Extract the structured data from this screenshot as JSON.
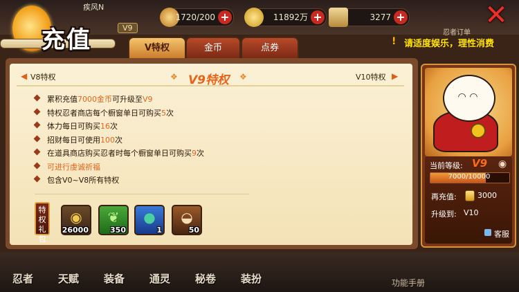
{
  "header": {
    "title": "充值",
    "player_name": "疾风N",
    "vip_badge": "V9"
  },
  "resources": {
    "energy": "1720/200",
    "coins": "11892万",
    "tickets": "3277"
  },
  "notice": "请适度娱乐，理性消费",
  "ninja_order": "忍者订单",
  "tabs": [
    {
      "label": "V特权"
    },
    {
      "label": "金币"
    },
    {
      "label": "点券"
    }
  ],
  "vip_nav": {
    "prev": "V8特权",
    "current": "V9特权",
    "next": "V10特权"
  },
  "benefits": [
    {
      "pre": "累积充值",
      "hl": "7000金币",
      "mid": "可升级至",
      "hl2": "V9",
      "post": ""
    },
    {
      "pre": "特权忍者商店每个橱窗单日可购买",
      "hl": "5",
      "mid": "次",
      "hl2": "",
      "post": ""
    },
    {
      "pre": "体力每日可购买",
      "hl": "16",
      "mid": "次",
      "hl2": "",
      "post": ""
    },
    {
      "pre": "招财每日可使用",
      "hl": "100",
      "mid": "次",
      "hl2": "",
      "post": ""
    },
    {
      "pre": "在道具商店购买忍者时每个橱窗单日可购买",
      "hl": "9",
      "mid": "次",
      "hl2": "",
      "post": ""
    },
    {
      "pre": "",
      "hl": "可进行虔诚祈福",
      "mid": "",
      "hl2": "",
      "post": ""
    },
    {
      "pre": "包含V0~V8所有特权",
      "hl": "",
      "mid": "",
      "hl2": "",
      "post": ""
    }
  ],
  "gift": {
    "label": "特权礼包",
    "items": [
      {
        "qty": "26000",
        "icon": "coin-icon"
      },
      {
        "qty": "350",
        "icon": "herb-icon"
      },
      {
        "qty": "1",
        "icon": "magatama-icon"
      },
      {
        "qty": "50",
        "icon": "ramen-icon"
      }
    ]
  },
  "card": {
    "level_label": "当前等级:",
    "level_value": "V9",
    "progress_text": "7000/10000",
    "progress_fraction": 0.7,
    "recharge_label": "再充值:",
    "recharge_value": "3000",
    "upgrade_label": "升级到:",
    "upgrade_value": "V10",
    "service": "客服"
  },
  "bottom_nav": [
    "忍者",
    "天赋",
    "装备",
    "通灵",
    "秘卷",
    "装扮"
  ],
  "manual": "功能手册",
  "colors": {
    "accent": "#e8641a",
    "panel": "#f7e8c4",
    "frame": "#7a4a2a"
  }
}
